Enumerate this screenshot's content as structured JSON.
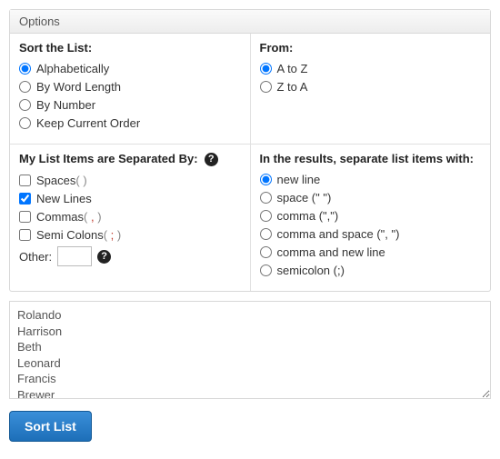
{
  "panel_title": "Options",
  "sort": {
    "title": "Sort the List:",
    "options": [
      {
        "label": "Alphabetically",
        "selected": true
      },
      {
        "label": "By Word Length",
        "selected": false
      },
      {
        "label": "By Number",
        "selected": false
      },
      {
        "label": "Keep Current Order",
        "selected": false
      }
    ]
  },
  "from": {
    "title": "From:",
    "options": [
      {
        "label": "A to Z",
        "selected": true
      },
      {
        "label": "Z to A",
        "selected": false
      }
    ]
  },
  "separators_in": {
    "title": "My List Items are Separated By:",
    "options": [
      {
        "label": "Spaces",
        "punct": "( )",
        "checked": false
      },
      {
        "label": "New Lines",
        "punct": "",
        "checked": true
      },
      {
        "label": "Commas",
        "punct": "( , )",
        "checked": false
      },
      {
        "label": "Semi Colons",
        "punct": "( ; )",
        "checked": false
      }
    ],
    "other_label": "Other:",
    "other_value": ""
  },
  "separators_out": {
    "title": "In the results, separate list items with:",
    "options": [
      {
        "label": "new line",
        "selected": true
      },
      {
        "label": "space (\" \")",
        "selected": false
      },
      {
        "label": "comma (\",\")",
        "selected": false
      },
      {
        "label": "comma and space (\", \")",
        "selected": false
      },
      {
        "label": "comma and new line",
        "selected": false
      },
      {
        "label": "semicolon (;)",
        "selected": false
      }
    ]
  },
  "textarea_value": "Rolando\nHarrison\nBeth\nLeonard\nFrancis\nBrewer",
  "button_label": "Sort List",
  "help_glyph": "?"
}
